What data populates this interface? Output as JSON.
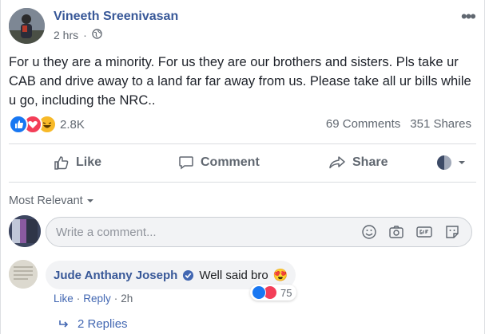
{
  "post": {
    "author": "Vineeth Sreenivasan",
    "time": "2 hrs",
    "audience_icon": "globe-icon",
    "more_icon": "more-options-icon",
    "text": "For u they are a minority. For us they are our brothers and sisters. Pls take ur CAB and drive away to a land far far away from us. Please take all ur bills while u go, including the NRC..",
    "reaction_count": "2.8K",
    "reaction_types": [
      "like",
      "love",
      "haha"
    ],
    "comments": "69 Comments",
    "shares": "351 Shares"
  },
  "actions": {
    "like": "Like",
    "comment": "Comment",
    "share": "Share"
  },
  "comments": {
    "sort_label": "Most Relevant",
    "placeholder": "Write a comment...",
    "input_icons": [
      "emoji-icon",
      "camera-icon",
      "gif-icon",
      "sticker-icon"
    ],
    "items": [
      {
        "author": "Jude Anthany Joseph",
        "verified": true,
        "text": "Well said bro",
        "emoji": "😍",
        "like_label": "Like",
        "reply_label": "Reply",
        "time": "2h",
        "reaction_count": "75",
        "reaction_types": [
          "like",
          "love"
        ],
        "replies": "2 Replies"
      }
    ]
  },
  "colors": {
    "link": "#385898",
    "like_blue": "#1877f2",
    "love_red": "#f33e58",
    "haha_yellow": "#f7b928",
    "muted": "#606770"
  }
}
